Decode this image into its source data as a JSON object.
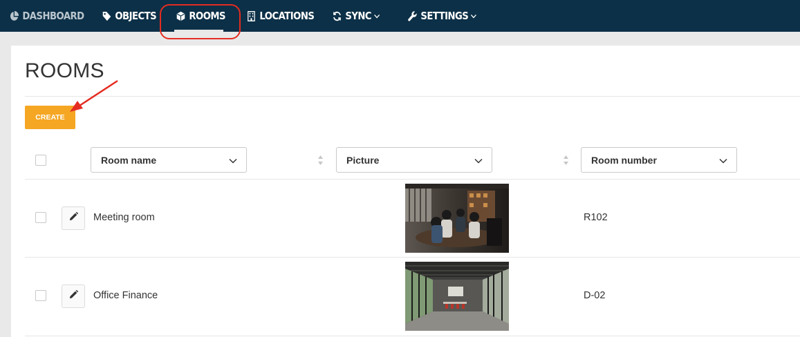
{
  "nav": {
    "items": [
      {
        "label": "DASHBOARD",
        "icon": "pie-chart-icon",
        "active": false
      },
      {
        "label": "OBJECTS",
        "icon": "tag-icon",
        "active": false
      },
      {
        "label": "ROOMS",
        "icon": "cube-icon",
        "active": true
      },
      {
        "label": "LOCATIONS",
        "icon": "building-icon",
        "active": false
      },
      {
        "label": "SYNC",
        "icon": "refresh-icon",
        "active": false,
        "dropdown": true
      },
      {
        "label": "SETTINGS",
        "icon": "wrench-icon",
        "active": false,
        "dropdown": true
      }
    ],
    "colors": {
      "background": "#0c3047",
      "text": "#ffffff",
      "annotation": "#e52c21"
    }
  },
  "page": {
    "title": "ROOMS",
    "create_label": "CREATE",
    "accent": "#f5a623"
  },
  "table": {
    "columns": [
      {
        "label": "Room name"
      },
      {
        "label": "Picture"
      },
      {
        "label": "Room number"
      }
    ],
    "rows": [
      {
        "name": "Meeting room",
        "picture": "meeting-room-photo",
        "number": "R102"
      },
      {
        "name": "Office Finance",
        "picture": "office-interior-photo",
        "number": "D-02"
      }
    ]
  }
}
